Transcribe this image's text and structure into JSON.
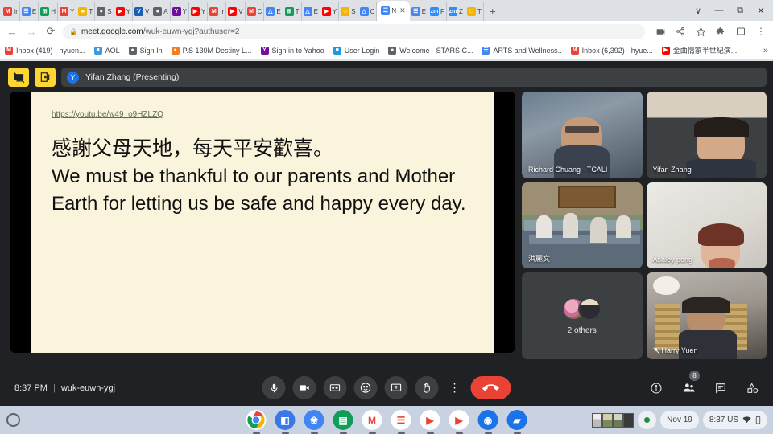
{
  "browser": {
    "tabs": [
      {
        "label": "Ir",
        "icon": "gmail-icon",
        "color": "#ea4335",
        "glyph": "M"
      },
      {
        "label": "E",
        "icon": "docs-icon",
        "color": "#4285f4",
        "glyph": "☰"
      },
      {
        "label": "H",
        "icon": "sheets-icon",
        "color": "#0f9d58",
        "glyph": "⊞"
      },
      {
        "label": "Y",
        "icon": "gmail-icon",
        "color": "#ea4335",
        "glyph": "M"
      },
      {
        "label": "T",
        "icon": "slides-icon",
        "color": "#f4b400",
        "glyph": "■"
      },
      {
        "label": "S",
        "icon": "globe-icon",
        "color": "#5f6368",
        "glyph": "●"
      },
      {
        "label": "Y",
        "icon": "youtube-icon",
        "color": "#ff0000",
        "glyph": "▶"
      },
      {
        "label": "V",
        "icon": "vimeo-icon",
        "color": "#1a5fb4",
        "glyph": "V"
      },
      {
        "label": "A",
        "icon": "globe-icon",
        "color": "#5f6368",
        "glyph": "●"
      },
      {
        "label": "Y",
        "icon": "yahoo-icon",
        "color": "#720e9e",
        "glyph": "Y"
      },
      {
        "label": "Y",
        "icon": "youtube-icon",
        "color": "#ff0000",
        "glyph": "▶"
      },
      {
        "label": "Ir",
        "icon": "gmail-icon",
        "color": "#ea4335",
        "glyph": "M"
      },
      {
        "label": "V",
        "icon": "youtube-icon",
        "color": "#ff0000",
        "glyph": "▶"
      },
      {
        "label": "C",
        "icon": "gmail-icon",
        "color": "#ea4335",
        "glyph": "M"
      },
      {
        "label": "E",
        "icon": "drive-icon",
        "color": "#4285f4",
        "glyph": "△"
      },
      {
        "label": "T",
        "icon": "sheets-icon",
        "color": "#0f9d58",
        "glyph": "⊞"
      },
      {
        "label": "E",
        "icon": "drive-icon",
        "color": "#4285f4",
        "glyph": "△"
      },
      {
        "label": "Y",
        "icon": "youtube-icon",
        "color": "#ff0000",
        "glyph": "▶"
      },
      {
        "label": "S",
        "icon": "contacts-icon",
        "color": "#f4b400",
        "glyph": "☺"
      },
      {
        "label": "C",
        "icon": "drive-icon",
        "color": "#4285f4",
        "glyph": "△"
      },
      {
        "label": "N",
        "icon": "meet-icon",
        "color": "#ffffff",
        "glyph": "",
        "active": true
      },
      {
        "label": "E",
        "icon": "docs-icon",
        "color": "#4285f4",
        "glyph": "☰"
      },
      {
        "label": "F",
        "icon": "zoom-icon",
        "color": "#2d8cff",
        "glyph": "zm"
      },
      {
        "label": "Z",
        "icon": "zoom-icon",
        "color": "#2d8cff",
        "glyph": "zm"
      },
      {
        "label": "T",
        "icon": "window-icon",
        "color": "#f4b400",
        "glyph": "□"
      }
    ],
    "new_tab_label": "+",
    "window_controls": {
      "dropdown": "∨",
      "minimize": "—",
      "maximize": "⧉",
      "close": "✕"
    },
    "toolbar": {
      "back": "←",
      "forward": "→",
      "reload": "⟳",
      "lock_icon": "lock-icon",
      "url_domain": "meet.google.com",
      "url_path": "/wuk-euwn-ygj?authuser=2",
      "cast_icon": "cast-icon",
      "share_icon": "share-icon",
      "bookmark_icon": "star-icon",
      "extensions_icon": "puzzle-icon",
      "sidepanel_icon": "side-panel-icon",
      "menu_icon": "three-dot-menu-icon"
    },
    "bookmarks": [
      {
        "label": "Inbox (419) - hyuen...",
        "color": "#ea4335",
        "glyph": "M"
      },
      {
        "label": "AOL",
        "color": "#3b9ae1",
        "glyph": "■"
      },
      {
        "label": "Sign In",
        "color": "#5f6368",
        "glyph": "●"
      },
      {
        "label": "P.S 130M Destiny L...",
        "color": "#f47b20",
        "glyph": "●"
      },
      {
        "label": "Sign in to Yahoo",
        "color": "#720e9e",
        "glyph": "Y"
      },
      {
        "label": "User Login",
        "color": "#1a9be0",
        "glyph": "■"
      },
      {
        "label": "Welcome - STARS C...",
        "color": "#5f6368",
        "glyph": "●"
      },
      {
        "label": "ARTS and Wellness..",
        "color": "#4285f4",
        "glyph": "☰"
      },
      {
        "label": "Inbox (6,392) - hyue...",
        "color": "#ea4335",
        "glyph": "M"
      },
      {
        "label": "金曲情家半世紀演...",
        "color": "#ff0000",
        "glyph": "▶"
      }
    ],
    "bookmarks_overflow": "»"
  },
  "meet": {
    "present_bar": {
      "stop_presenting_icon": "stop-presenting-icon",
      "leave_presentation_icon": "exit-presentation-icon",
      "avatar_letter": "Y",
      "presenter_label": "Yifan Zhang (Presenting)"
    },
    "slide": {
      "link": "https://youtu.be/w49_o9HZLZQ",
      "chinese_line": "感謝父母天地，每天平安歡喜。",
      "english_line": "We must be thankful to our parents and Mother Earth for letting us be safe and happy every day.",
      "background_color": "#faf4dc"
    },
    "tiles": [
      {
        "name": "Richard Chuang - TCALI",
        "type": "video",
        "muted": false
      },
      {
        "name": "Yifan Zhang",
        "type": "video",
        "muted": false
      },
      {
        "name": "洪麗文",
        "type": "video",
        "muted": false
      },
      {
        "name": "Ashley pong",
        "type": "video",
        "muted": false
      },
      {
        "name": "2 others",
        "type": "others",
        "muted": false
      },
      {
        "name": "Harry Yuen",
        "type": "video",
        "muted": true
      }
    ],
    "bottom": {
      "time": "8:37 PM",
      "separator": "|",
      "meeting_code": "wuk-euwn-ygj",
      "controls": [
        {
          "name": "microphone-button",
          "icon": "microphone-icon"
        },
        {
          "name": "camera-button",
          "icon": "video-camera-icon"
        },
        {
          "name": "captions-button",
          "icon": "closed-captions-icon"
        },
        {
          "name": "emoji-button",
          "icon": "smiley-face-icon"
        },
        {
          "name": "present-now-button",
          "icon": "present-screen-icon"
        },
        {
          "name": "raise-hand-button",
          "icon": "raised-hand-icon"
        },
        {
          "name": "more-options-button",
          "icon": "three-dot-menu-icon"
        },
        {
          "name": "leave-call-button",
          "icon": "hang-up-phone-icon"
        }
      ],
      "right_icons": [
        {
          "name": "meeting-details-button",
          "icon": "info-circle-icon"
        },
        {
          "name": "show-everyone-button",
          "icon": "people-icon",
          "badge": "8"
        },
        {
          "name": "chat-button",
          "icon": "chat-bubble-icon"
        },
        {
          "name": "activities-button",
          "icon": "activities-shapes-icon"
        }
      ]
    }
  },
  "shelf": {
    "launcher_icon": "launcher-circle-icon",
    "apps": [
      {
        "name": "chrome",
        "glyph": "",
        "color": "#ffffff"
      },
      {
        "name": "files",
        "glyph": "◧",
        "color": "#3b78e7"
      },
      {
        "name": "gallery",
        "glyph": "❀",
        "color": "#4285f4"
      },
      {
        "name": "classroom",
        "glyph": "▤",
        "color": "#0f9d58"
      },
      {
        "name": "gmail",
        "glyph": "M",
        "color": "#ffffff"
      },
      {
        "name": "google-docs",
        "glyph": "☰",
        "color": "#ffffff"
      },
      {
        "name": "youtube",
        "glyph": "▶",
        "color": "#ffffff"
      },
      {
        "name": "play-store",
        "glyph": "▶",
        "color": "#ffffff"
      },
      {
        "name": "camera",
        "glyph": "◉",
        "color": "#1a73e8"
      },
      {
        "name": "files-blue",
        "glyph": "▰",
        "color": "#1a73e8"
      }
    ],
    "tray": {
      "status_dot": "recording-dot",
      "date": "Nov 19",
      "time": "8:37 US",
      "wifi_icon": "wifi-icon",
      "battery_icon": "battery-icon"
    }
  }
}
